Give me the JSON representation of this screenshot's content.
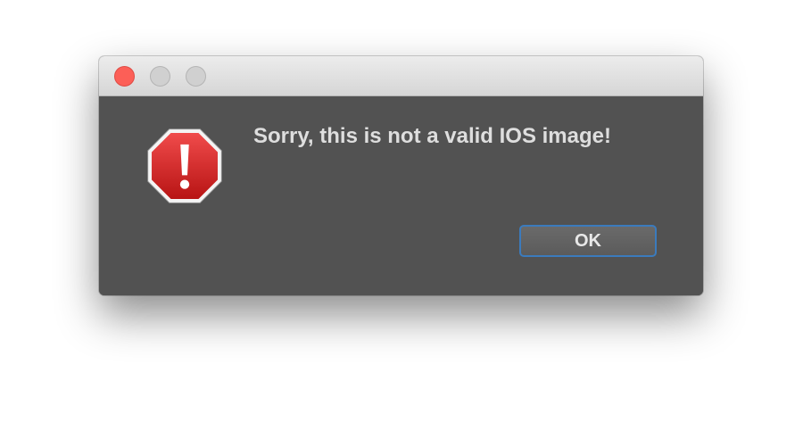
{
  "dialog": {
    "message": "Sorry, this is not a valid IOS image!",
    "ok_label": "OK",
    "icon": "warning-stop-icon"
  },
  "titlebar": {
    "buttons": [
      "close",
      "minimize",
      "zoom"
    ]
  },
  "colors": {
    "background": "#525252",
    "titlebar": "#e2e2e2",
    "close": "#fc5f57",
    "inactive_traffic": "#d0d0d0",
    "alert_red": "#d42323",
    "button_focus": "#3b7bbd",
    "text": "#dedede"
  }
}
